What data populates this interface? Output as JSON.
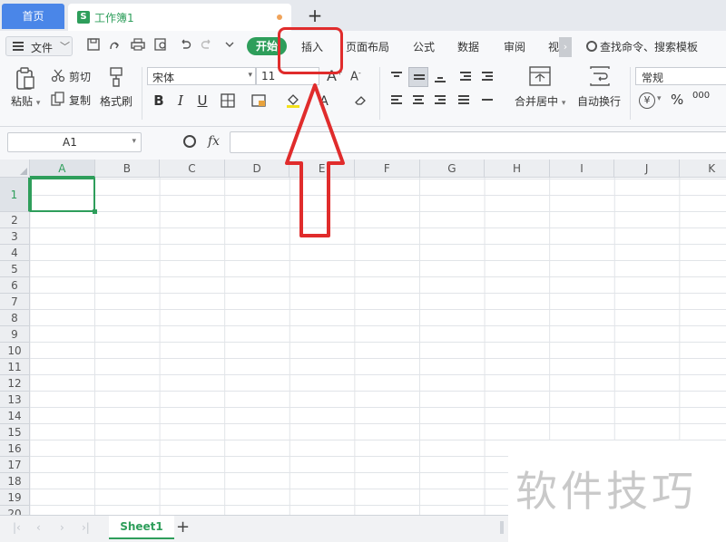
{
  "titlebar": {
    "home_tab": "首页",
    "doc_icon": "S",
    "doc_title": "工作簿1"
  },
  "menubar": {
    "file_label": "文件",
    "start_tab": "开始",
    "insert_tab": "插入",
    "page_layout_tab": "页面布局",
    "formula_tab": "公式",
    "data_tab": "数据",
    "review_tab": "审阅",
    "view_tab_partial": "视",
    "search_label": "查找命令、搜索模板"
  },
  "ribbon": {
    "paste_label": "粘贴",
    "cut_label": "剪切",
    "copy_label": "复制",
    "format_painter_label": "格式刷",
    "font_name": "宋体",
    "font_size": "11",
    "merge_center_label": "合并居中",
    "wrap_text_label": "自动换行",
    "number_format": "常规",
    "currency_symbol": "¥",
    "percent_symbol": "%",
    "thousands_symbol": "000"
  },
  "formulabar": {
    "name_box": "A1",
    "fx_label": "fx",
    "formula_value": ""
  },
  "grid": {
    "columns": [
      "A",
      "B",
      "C",
      "D",
      "E",
      "F",
      "G",
      "H",
      "I",
      "J",
      "K"
    ],
    "rows": [
      "1",
      "2",
      "3",
      "4",
      "5",
      "6",
      "7",
      "8",
      "9",
      "10",
      "11",
      "12",
      "13",
      "14",
      "15",
      "16",
      "17",
      "18",
      "19",
      "20"
    ],
    "active_cell": "A1"
  },
  "sheets": {
    "tabs": [
      "Sheet1"
    ],
    "active": "Sheet1"
  },
  "watermark": "软件技巧",
  "colors": {
    "accent_green": "#2e9e5b",
    "home_tab_blue": "#4a86e8",
    "annotation_red": "#e02c2c"
  }
}
